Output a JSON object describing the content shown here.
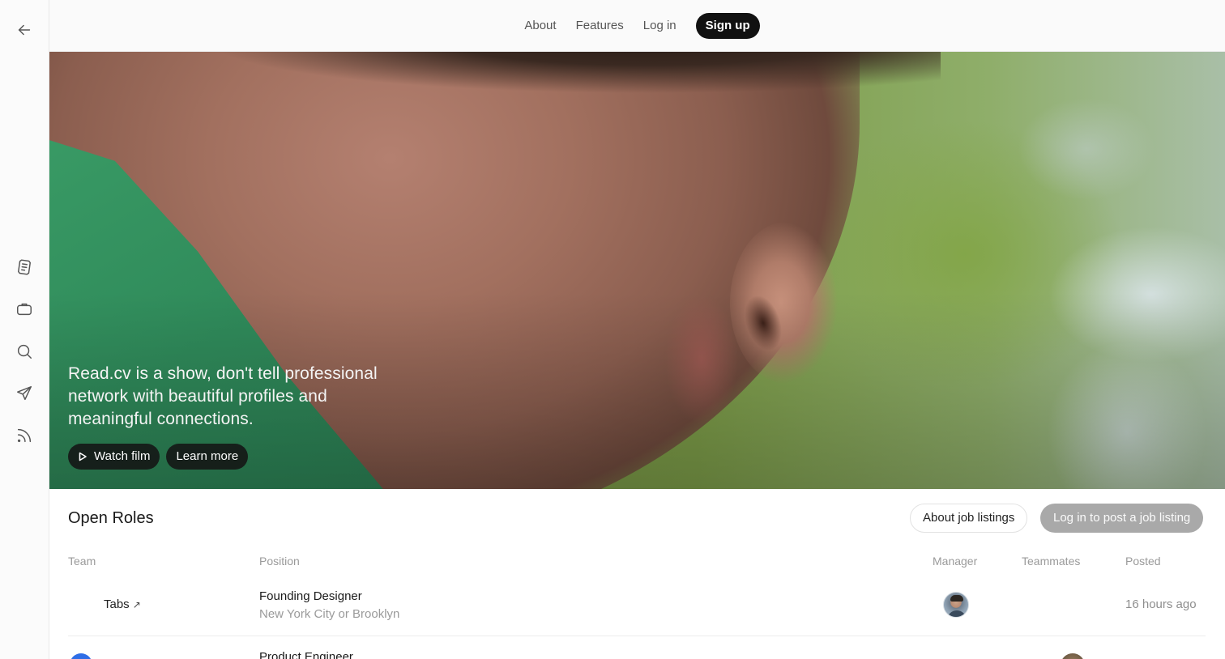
{
  "nav": {
    "about": "About",
    "features": "Features",
    "login": "Log in",
    "signup": "Sign up"
  },
  "rail": {
    "icons": [
      "back-arrow-icon",
      "document-icon",
      "briefcase-icon",
      "search-icon",
      "send-icon",
      "rss-icon"
    ]
  },
  "hero": {
    "tagline": "Read.cv is a show, don't tell professional network with beautiful profiles and meaningful connections.",
    "watch_film": "Watch film",
    "learn_more": "Learn more"
  },
  "roles": {
    "title": "Open Roles",
    "about_button": "About job listings",
    "post_button": "Log in to post a job listing",
    "columns": {
      "team": "Team",
      "position": "Position",
      "manager": "Manager",
      "teammates": "Teammates",
      "posted": "Posted"
    },
    "rows": [
      {
        "team": "Tabs",
        "team_link_icon": "arrow-up-right-icon",
        "position": "Founding Designer",
        "location": "New York City or Brooklyn",
        "posted": "16 hours ago"
      },
      {
        "team": "",
        "position": "Product Engineer",
        "location": "",
        "posted": ""
      }
    ]
  },
  "colors": {
    "signup_bg": "#111111",
    "post_button_bg": "#a9a9a9",
    "team_logo_blue": "#2f6ee6"
  }
}
